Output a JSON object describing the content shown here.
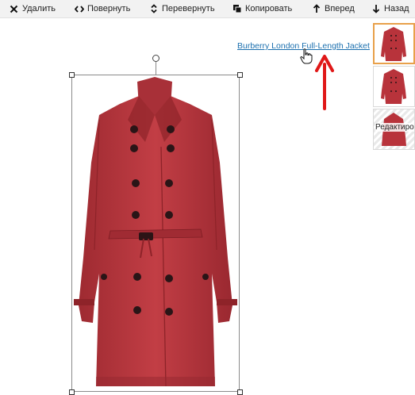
{
  "toolbar": {
    "delete": "Удалить",
    "rotate": "Повернуть",
    "flip": "Перевернуть",
    "copy": "Копировать",
    "forward": "Вперед",
    "back": "Назад"
  },
  "canvas": {
    "product_link": "Burberry London Full-Length Jacket"
  },
  "thumbnails": {
    "edit_label": "Редактиров"
  },
  "colors": {
    "coat": "#b8333b",
    "coat_dark": "#8e2329",
    "link": "#1a6fae",
    "arrow": "#e01818",
    "active_thumb_border": "#e8a04a"
  },
  "icons": [
    "close-icon",
    "rotate-arrows-icon",
    "flip-icon",
    "copy-icon",
    "arrow-up-icon",
    "arrow-down-icon",
    "hand-pointer-icon"
  ]
}
